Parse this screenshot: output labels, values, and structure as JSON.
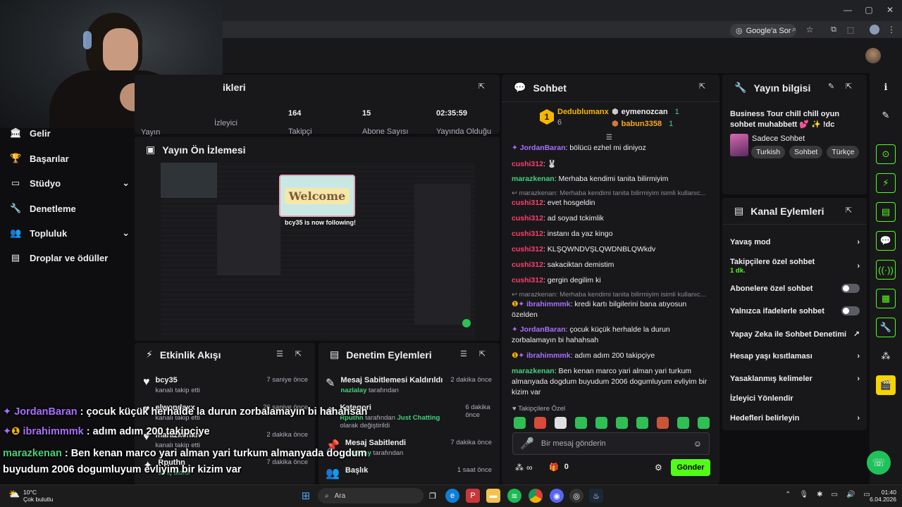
{
  "browser": {
    "window_controls": [
      "—",
      "▢",
      "✕"
    ],
    "google_ask_label": "Google'a Sor"
  },
  "sidebar": {
    "items": [
      {
        "label": "Gelir",
        "icon": "bank-icon"
      },
      {
        "label": "Başarılar",
        "icon": "trophy-icon"
      },
      {
        "label": "Stüdyo",
        "icon": "studio-icon",
        "chevron": true
      },
      {
        "label": "Denetleme",
        "icon": "wrench-icon"
      },
      {
        "label": "Topluluk",
        "icon": "community-icon",
        "chevron": true
      },
      {
        "label": "Droplar ve ödüller",
        "icon": "drops-icon"
      }
    ]
  },
  "stats": {
    "title_partial": "ikleri",
    "label_partial": "Yayın",
    "items": [
      {
        "value": "",
        "label": "İzleyici"
      },
      {
        "value": "164",
        "label": "Takipçi"
      },
      {
        "value": "15",
        "label": "Abone Sayısı"
      },
      {
        "value": "02:35:59",
        "label": "Yayında Olduğu"
      }
    ]
  },
  "preview": {
    "title": "Yayın Ön İzlemesi",
    "welcome_text": "Welcome",
    "follow_alert": "bcy35 is now following!"
  },
  "activity": {
    "title": "Etkinlik Akışı",
    "rows": [
      {
        "name": "bcy35",
        "sub": "kanalı takip etti",
        "time": "7 saniye önce"
      },
      {
        "name": "elwondaxx",
        "sub": "kanalı takip etti",
        "time": "26 saniye önce"
      },
      {
        "name": "marazkenan",
        "sub": "kanalı takip etti",
        "time": "2 dakika önce"
      },
      {
        "name": "Rputhn",
        "sub": "su iç aldıdi",
        "time": "7 dakika önce"
      }
    ]
  },
  "mod_actions": {
    "title": "Denetim Eylemleri",
    "rows": [
      {
        "title": "Mesaj Sabitlemesi Kaldırıldı",
        "user": "nazlalay",
        "rest": " tarafından",
        "time": "2 dakika önce"
      },
      {
        "title": "Kategori",
        "user": "Rputhn",
        "rest": " tarafından ",
        "extra": "Just Chatting",
        "rest2": " olarak değiştirildi",
        "time": "6 dakika önce"
      },
      {
        "title": "Mesaj Sabitlendi",
        "user": "nazlalay",
        "rest": " tarafından",
        "time": "7 dakika önce"
      },
      {
        "title": "Başlık",
        "time": "1 saat önce"
      }
    ]
  },
  "chat": {
    "title": "Sohbet",
    "leaderboard": [
      {
        "rank": "1",
        "name": "Dedublumanx",
        "count": "6"
      },
      {
        "name": "eymenozcan",
        "count": "1"
      },
      {
        "name": "babun3358",
        "count": "1"
      }
    ],
    "messages": [
      {
        "user": "JordanBaran",
        "color": "purple",
        "text": "bölücü ezhel mi diniyoz"
      },
      {
        "user": "cushi312",
        "color": "red",
        "text": "🐰"
      },
      {
        "user": "marazkenan",
        "color": "green",
        "text": "Merhaba kendimi tanita bilirmiyim"
      },
      {
        "reply": "↩ marazkenan: Merhaba kendimi tanita bilirmiyim isimli kullanıc..."
      },
      {
        "user": "cushi312",
        "color": "red",
        "text": "evet hosgeldin"
      },
      {
        "user": "cushi312",
        "color": "red",
        "text": "ad soyad tckimlik"
      },
      {
        "user": "cushi312",
        "color": "red",
        "text": "instanı da yaz kingo"
      },
      {
        "user": "cushi312",
        "color": "red",
        "text": "KLŞQWNDVŞLQWDNBLQWkdv"
      },
      {
        "user": "cushi312",
        "color": "red",
        "text": "sakaciktan demistim"
      },
      {
        "user": "cushi312",
        "color": "red",
        "text": "gergin degilim ki"
      },
      {
        "reply": "↩ marazkenan: Merhaba kendimi tanita bilirmiyim isimli kullanıc..."
      },
      {
        "user": "ibrahimmmk",
        "color": "purple",
        "text": "kredi kartı bilgilerini bana atıyosun özelden"
      },
      {
        "user": "JordanBaran",
        "color": "purple",
        "text": "çocuk küçük herhalde la durun zorbalamayın bi hahahsah"
      },
      {
        "user": "ibrahimmmk",
        "color": "purple",
        "text": "adım adım 200 takipçiye"
      },
      {
        "user": "marazkenan",
        "color": "green",
        "text": "Ben kenan marco yari alman yari turkum almanyada dogdum buyudum 2006 dogumluyum evliyim bir kizim var"
      }
    ],
    "followers_only": "Takipçilere Özel",
    "input_placeholder": "Bir mesaj gönderin",
    "points": "0",
    "send_label": "Gönder"
  },
  "stream_info": {
    "title": "Yayın bilgisi",
    "stream_title": "Business Tour chill chill oyun sohbet muhabbett 💕 ✨ !dc",
    "category": "Sadece Sohbet",
    "tags": [
      "Turkish",
      "Sohbet",
      "Türkçe"
    ]
  },
  "channel_actions": {
    "title": "Kanal Eylemleri",
    "rows": [
      {
        "label": "Yavaş mod",
        "kind": "chevron"
      },
      {
        "label": "Takipçilere özel sohbet",
        "sub": "1 dk.",
        "kind": "chevron"
      },
      {
        "label": "Abonelere özel sohbet",
        "kind": "toggle"
      },
      {
        "label": "Yalnızca ifadelerle sohbet",
        "kind": "toggle"
      },
      {
        "label": "Yapay Zeka ile Sohbet Denetimi",
        "kind": "external"
      },
      {
        "label": "Hesap yaşı kısıtlaması",
        "kind": "chevron"
      },
      {
        "label": "Yasaklanmış kelimeler",
        "kind": "chevron"
      },
      {
        "label": "İzleyici Yönlendir",
        "kind": "none"
      },
      {
        "label": "Hedefleri belirleyin",
        "kind": "chevron"
      }
    ]
  },
  "overlay_chat": [
    {
      "user": "JordanBaran",
      "text": " : çocuk küçük herhalde la durun zorbalamayın bi hahahsah"
    },
    {
      "user": "ibrahimmmk",
      "text": " : adım adım 200 takipçiye"
    },
    {
      "user": "marazkenan",
      "text": " : Ben kenan marco yari alman yari turkum almanyada dogdum buyudum 2006 dogumluyum evliyim bir kizim var"
    }
  ],
  "taskbar": {
    "weather_temp": "10°C",
    "weather_desc": "Çok bulutlu",
    "search_placeholder": "Ara",
    "time": "01:40",
    "date": "6.04.2026"
  },
  "colors": {
    "accent_green": "#53fc18",
    "purple": "#a970ff",
    "red": "#ff3f6a"
  }
}
